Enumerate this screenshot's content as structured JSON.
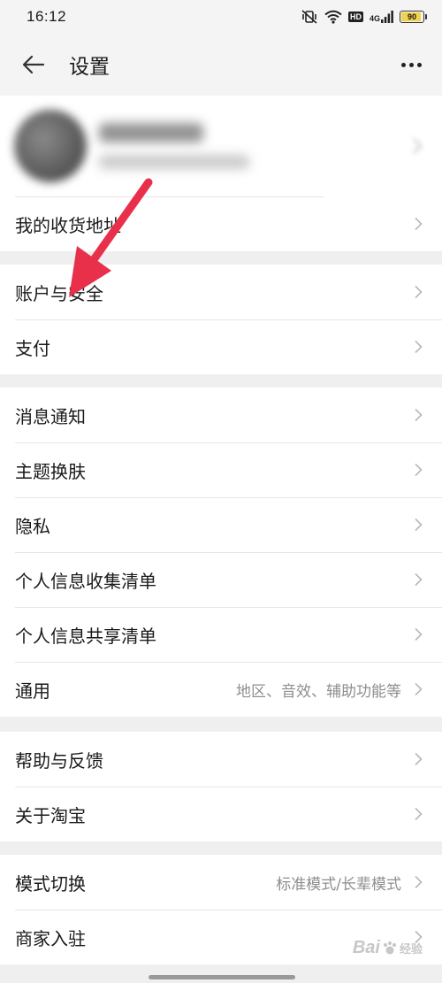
{
  "status_bar": {
    "time": "16:12",
    "hd_label": "HD",
    "network_label": "4G",
    "battery_level": "90"
  },
  "header": {
    "title": "设置",
    "back_icon": "arrow-left-icon",
    "more_icon": "more-horizontal-icon"
  },
  "profile": {
    "avatar_icon": "avatar-blurred"
  },
  "groups": [
    {
      "items": [
        {
          "label": "我的收货地址",
          "value": ""
        }
      ]
    },
    {
      "items": [
        {
          "label": "账户与安全",
          "value": ""
        },
        {
          "label": "支付",
          "value": ""
        }
      ]
    },
    {
      "items": [
        {
          "label": "消息通知",
          "value": ""
        },
        {
          "label": "主题换肤",
          "value": ""
        },
        {
          "label": "隐私",
          "value": ""
        },
        {
          "label": "个人信息收集清单",
          "value": ""
        },
        {
          "label": "个人信息共享清单",
          "value": ""
        },
        {
          "label": "通用",
          "value": "地区、音效、辅助功能等"
        }
      ]
    },
    {
      "items": [
        {
          "label": "帮助与反馈",
          "value": ""
        },
        {
          "label": "关于淘宝",
          "value": ""
        }
      ]
    },
    {
      "items": [
        {
          "label": "模式切换",
          "value": "标准模式/长辈模式"
        },
        {
          "label": "商家入驻",
          "value": ""
        }
      ]
    }
  ],
  "colors": {
    "annotation_arrow": "#e8304a",
    "background": "#efefef",
    "value_text": "#8e8e8e"
  },
  "watermark": {
    "logo": "Bai",
    "sub": "经验"
  }
}
